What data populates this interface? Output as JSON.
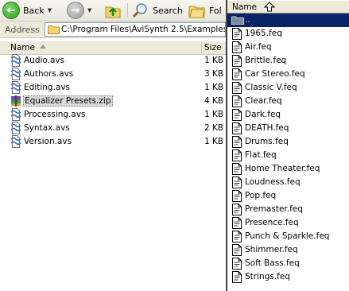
{
  "explorer": {
    "toolbar": {
      "back_label": "Back",
      "search_label": "Search",
      "folders_label": "Fol"
    },
    "address": {
      "label": "Address",
      "path": "C:\\Program Files\\AviSynth 2.5\\Examples"
    },
    "columns": {
      "name": "Name",
      "size": "Size"
    },
    "files": [
      {
        "name": "Audio.avs",
        "size": "1 KB",
        "icon": "avs-script-icon"
      },
      {
        "name": "Authors.avs",
        "size": "3 KB",
        "icon": "avs-script-icon"
      },
      {
        "name": "Editing.avs",
        "size": "1 KB",
        "icon": "avs-script-icon"
      },
      {
        "name": "Equalizer Presets.zip",
        "size": "4 KB",
        "icon": "zip-archive-icon",
        "selected": true
      },
      {
        "name": "Processing.avs",
        "size": "1 KB",
        "icon": "avs-script-icon"
      },
      {
        "name": "Syntax.avs",
        "size": "2 KB",
        "icon": "avs-script-icon"
      },
      {
        "name": "Version.avs",
        "size": "1 KB",
        "icon": "avs-script-icon"
      }
    ]
  },
  "panel": {
    "header": "Name",
    "parent_entry": "..",
    "files": [
      "1965.feq",
      "Air.feq",
      "Brittle.feq",
      "Car Stereo.feq",
      "Classic V.feq",
      "Clear.feq",
      "Dark.feq",
      "DEATH.feq",
      "Drums.feq",
      "Flat.feq",
      "Home Theater.feq",
      "Loudness.feq",
      "Pop.feq",
      "Premaster.feq",
      "Presence.feq",
      "Punch & Sparkle.feq",
      "Shimmer.feq",
      "Soft Bass.feq",
      "Strings.feq"
    ]
  },
  "colors": {
    "selection": "#0a246a",
    "toolbar": "#ece9d8"
  }
}
